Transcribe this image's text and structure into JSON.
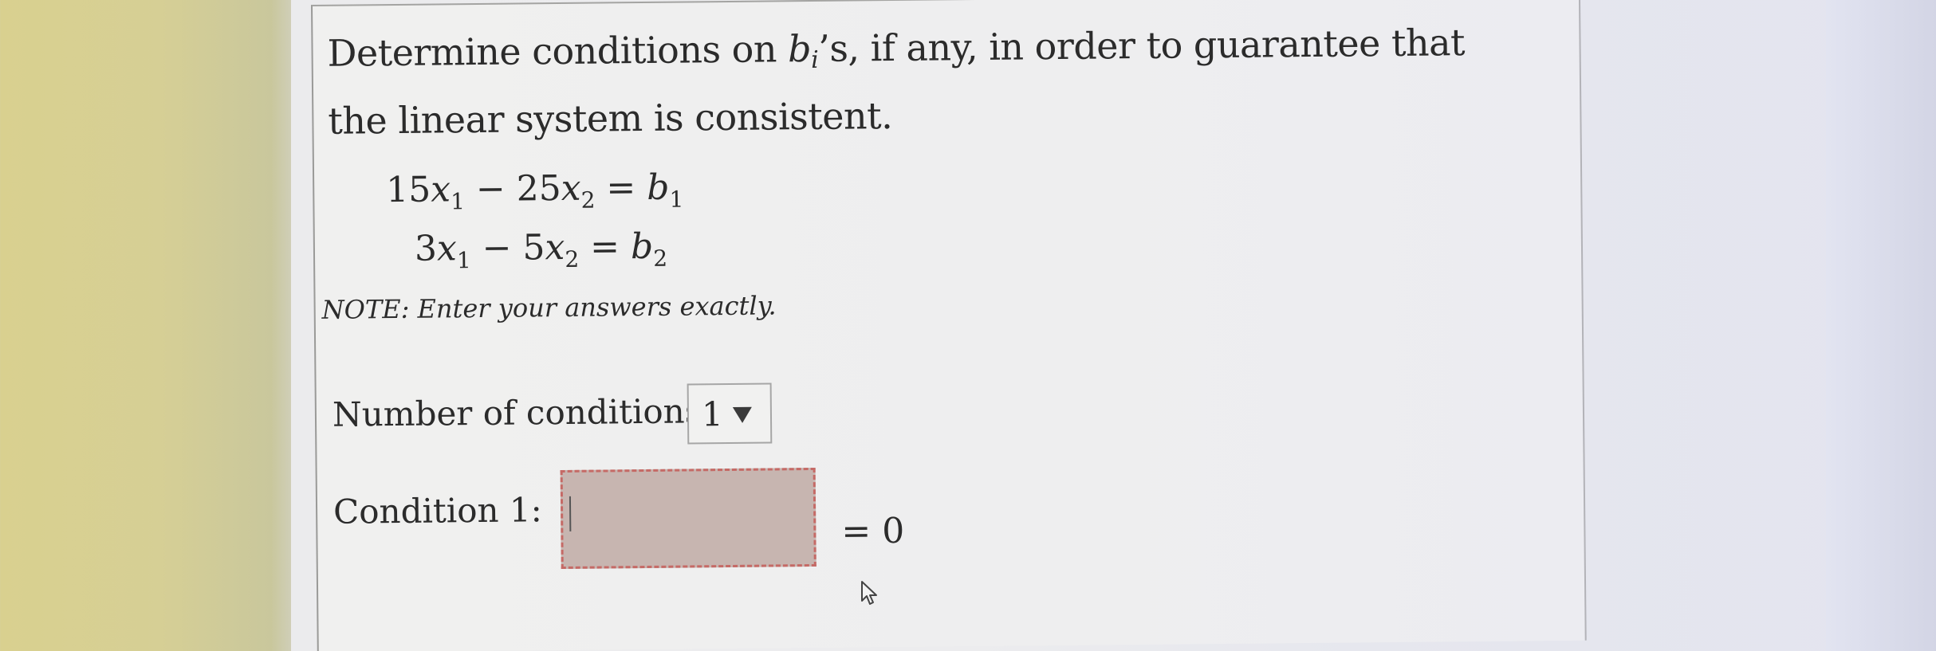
{
  "question": {
    "line1_before": "Determine conditions on ",
    "var_b": "b",
    "var_b_sub": "i",
    "line1_after": "’s, if any, in order to guarantee that",
    "line2": "the linear system is consistent."
  },
  "equations": [
    {
      "coef1": "15",
      "var1": "x",
      "sub1": "1",
      "op": " − ",
      "coef2": "25",
      "var2": "x",
      "sub2": "2",
      "eq": " = ",
      "rhs": "b",
      "rhs_sub": "1"
    },
    {
      "coef1": "3",
      "var1": "x",
      "sub1": "1",
      "op": " − ",
      "coef2": "5",
      "var2": "x",
      "sub2": "2",
      "eq": " = ",
      "rhs": "b",
      "rhs_sub": "2"
    }
  ],
  "note": "NOTE: Enter your answers exactly.",
  "conditions_count": {
    "label": "Number of conditions:",
    "selected": "1"
  },
  "condition1": {
    "label": "Condition 1:",
    "value": "",
    "equals": "= 0"
  },
  "colors": {
    "answer_fill": "#c7b5b0",
    "answer_border": "#c56a66",
    "text": "#2b2b2b"
  },
  "icons": {
    "dropdown": "triangle-down-icon",
    "pointer": "mouse-pointer-icon"
  }
}
